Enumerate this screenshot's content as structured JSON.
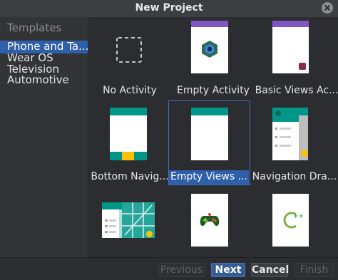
{
  "window": {
    "title": "New Project"
  },
  "sidebar": {
    "header": "Templates",
    "items": [
      {
        "label": "Phone and Ta...",
        "selected": true
      },
      {
        "label": "Wear OS"
      },
      {
        "label": "Television"
      },
      {
        "label": "Automotive"
      }
    ]
  },
  "templates": [
    {
      "label": "No Activity",
      "icon": "dashed-square-icon"
    },
    {
      "label": "Empty Activity",
      "icon": "compose-cube-icon"
    },
    {
      "label": "Basic Views Ac...",
      "icon": "fab-icon"
    },
    {
      "label": "Bottom Navig...",
      "icon": "bottom-nav-icon"
    },
    {
      "label": "Empty Views ...",
      "icon": "empty-views-icon",
      "selected": true
    },
    {
      "label": "Navigation Dra...",
      "icon": "drawer-icon"
    },
    {
      "label": "",
      "icon": "responsive-grid-icon"
    },
    {
      "label": "",
      "icon": "gamepad-icon"
    },
    {
      "label": "",
      "icon": "cpp-icon"
    }
  ],
  "footer": {
    "previous": "Previous",
    "next": "Next",
    "cancel": "Cancel",
    "finish": "Finish"
  },
  "colors": {
    "accent": "#2f5fa8",
    "compose_purple": "#7e57c2",
    "views_teal": "#009688",
    "amber": "#ffc107"
  }
}
